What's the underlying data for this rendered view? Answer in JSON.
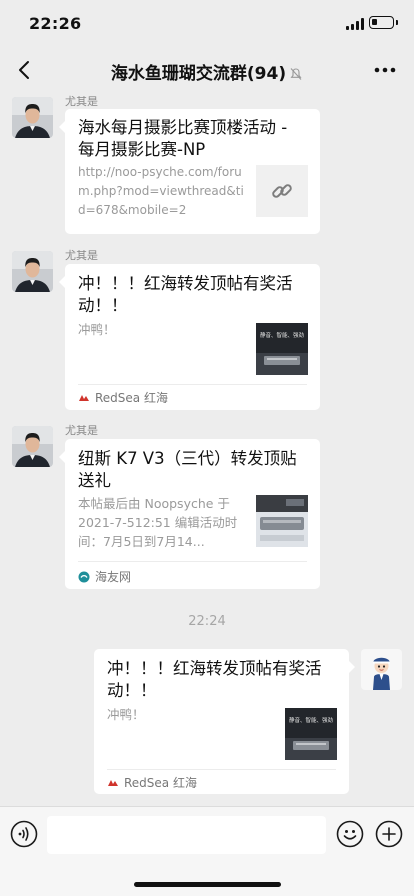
{
  "status_bar": {
    "time": "22:26",
    "battery_level": 0.3
  },
  "nav": {
    "title": "海水鱼珊瑚交流群(94)",
    "back_icon": "chevron-left-icon",
    "more_icon": "ellipsis-icon",
    "mute_icon": "bell-muted-icon"
  },
  "messages": [
    {
      "sender": "尤其是",
      "card": {
        "type": "link",
        "title": "海水每月摄影比赛顶楼活动 - 每月摄影比赛-NP",
        "desc": "http://noo-psyche.com/forum.php?mod=viewthread&tid=678&mobile=2",
        "thumb_icon": "link-icon"
      }
    },
    {
      "sender": "尤其是",
      "card": {
        "type": "article",
        "title": "冲！！！红海转发顶帖有奖活动！！",
        "desc": "冲鸭！",
        "source": "RedSea 红海",
        "source_icon": "redsea-logo-icon",
        "thumb_text": "静音、智能、强劲"
      }
    },
    {
      "sender": "尤其是",
      "card": {
        "type": "article",
        "title": "纽斯 K7 V3（三代）转发顶贴送礼",
        "desc": "本帖最后由 Noopsyche 于 2021-7-512:51 编辑活动时间：7月5日到7月14...",
        "source": "海友网",
        "source_icon": "haiyou-logo-icon"
      }
    }
  ],
  "timestamp": "22:24",
  "my_message": {
    "card": {
      "type": "article",
      "title": "冲！！！红海转发顶帖有奖活动！！",
      "desc": "冲鸭！",
      "source": "RedSea 红海",
      "source_icon": "redsea-logo-icon",
      "thumb_text": "静音、智能、强劲"
    }
  },
  "input_bar": {
    "voice_icon": "voice-icon",
    "emoji_icon": "emoji-icon",
    "plus_icon": "plus-icon",
    "placeholder": ""
  },
  "colors": {
    "background": "#ededed",
    "bubble": "#ffffff",
    "secondary_text": "#9a9a9a",
    "redsea": "#d0342c",
    "haiyou": "#1f8f9a"
  }
}
